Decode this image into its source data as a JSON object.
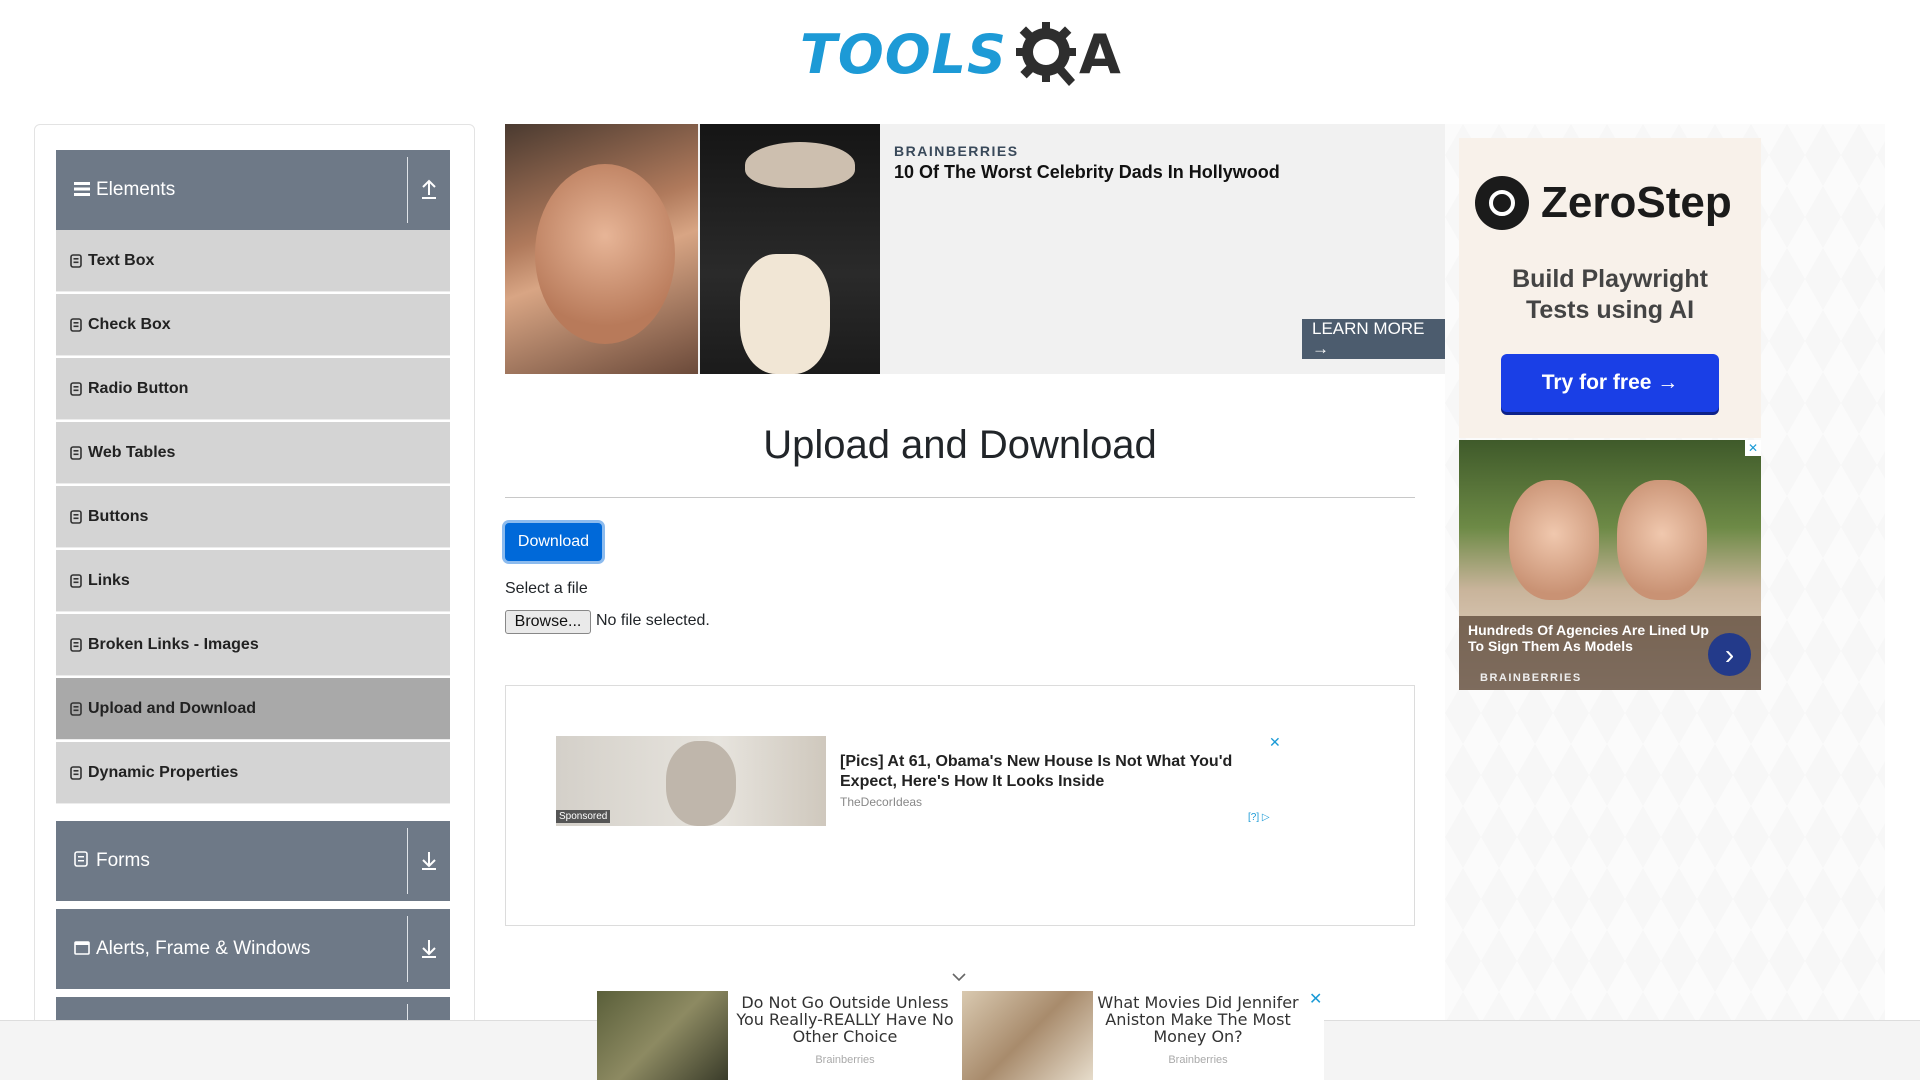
{
  "header": {
    "logo_tools": "TOOLS",
    "logo_a": "A"
  },
  "sidebar": {
    "groups": [
      {
        "label": "Elements",
        "icon": "hamburger-icon",
        "toggle": "collapse-up-icon"
      },
      {
        "label": "Forms",
        "icon": "form-icon",
        "toggle": "expand-down-icon"
      },
      {
        "label": "Alerts, Frame & Windows",
        "icon": "window-icon",
        "toggle": "expand-down-icon"
      }
    ],
    "items": [
      {
        "label": "Text Box"
      },
      {
        "label": "Check Box"
      },
      {
        "label": "Radio Button"
      },
      {
        "label": "Web Tables"
      },
      {
        "label": "Buttons"
      },
      {
        "label": "Links"
      },
      {
        "label": "Broken Links - Images"
      },
      {
        "label": "Upload and Download",
        "active": true
      },
      {
        "label": "Dynamic Properties"
      }
    ]
  },
  "top_ad": {
    "source": "BRAINBERRIES",
    "headline": "10 Of The Worst Celebrity Dads In Hollywood",
    "cta": "LEARN MORE →"
  },
  "right_ad": {
    "brand": "ZeroStep",
    "tagline_line1": "Build Playwright",
    "tagline_line2": "Tests using AI",
    "button": "Try for free →",
    "caption": "Hundreds Of Agencies Are Lined Up To Sign Them As Models",
    "caption_source": "BRAINBERRIES",
    "close": "✕"
  },
  "main": {
    "title": "Upload and Download",
    "download_button": "Download",
    "select_label": "Select a file",
    "browse_button": "Browse...",
    "no_file": "No file selected."
  },
  "mid_ad": {
    "sponsored": "Sponsored",
    "headline": "[Pics] At 61, Obama's New House Is Not What You'd Expect, Here's How It Looks Inside",
    "source": "TheDecorIdeas",
    "close": "✕",
    "adchoice": "[?]"
  },
  "bottom_ad": {
    "item1_text": "Do Not Go Outside Unless You Really-REALLY Have No Other Choice",
    "item1_source": "Brainberries",
    "item2_text": "What Movies Did Jennifer Aniston Make The Most Money On?",
    "item2_source": "Brainberries",
    "close": "✕"
  },
  "colors": {
    "brand_blue": "#1d9ad6",
    "sidebar_header": "#6e7987",
    "sidebar_item": "#d4d4d4",
    "sidebar_item_active": "#a9a9a9",
    "primary_button": "#0069d9"
  }
}
